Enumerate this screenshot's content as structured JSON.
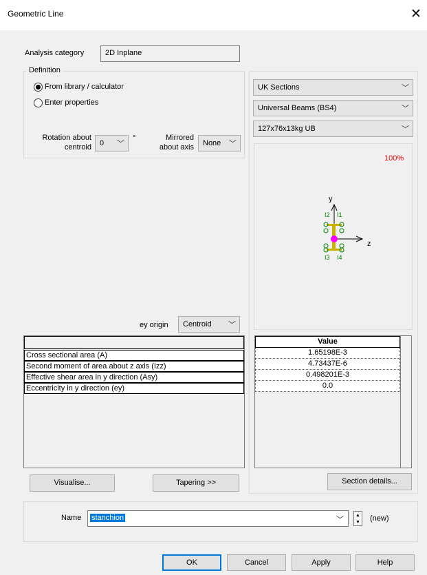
{
  "window": {
    "title": "Geometric Line",
    "close_icon": "✕"
  },
  "analysis_category": {
    "label": "Analysis category",
    "value": "2D Inplane"
  },
  "definition": {
    "legend": "Definition",
    "option_library": "From library / calculator",
    "option_enter": "Enter properties",
    "selected": "library"
  },
  "rotation": {
    "label_line1": "Rotation about",
    "label_line2": "centroid",
    "value": "0",
    "unit": "°"
  },
  "mirrored": {
    "label_line1": "Mirrored",
    "label_line2": "about axis",
    "value": "None"
  },
  "library": {
    "standard": "UK Sections",
    "family": "Universal Beams (BS4)",
    "section": "127x76x13kg UB"
  },
  "preview": {
    "zoom": "100%",
    "y_axis": "y",
    "z_axis": "z",
    "p1": "I1",
    "p2": "I2",
    "p3": "I3",
    "p4": "I4",
    "colors": {
      "zoom": "#ff0000",
      "points": "#008000",
      "flange": "#c8b400",
      "centroid": "#ff00ff"
    }
  },
  "ey_origin": {
    "label": "ey origin",
    "value": "Centroid"
  },
  "properties_table": {
    "value_header": "Value",
    "rows": [
      {
        "name": "Cross sectional area (A)",
        "value": "1.65198E-3"
      },
      {
        "name": "Second moment of area about z axis (Izz)",
        "value": "4.73437E-6"
      },
      {
        "name": "Effective shear area in y direction (Asy)",
        "value": "0.498201E-3"
      },
      {
        "name": "Eccentricity in y direction (ey)",
        "value": "0.0"
      }
    ]
  },
  "buttons": {
    "visualise": "Visualise...",
    "tapering": "Tapering >>",
    "section_details": "Section details...",
    "ok": "OK",
    "cancel": "Cancel",
    "apply": "Apply",
    "help": "Help"
  },
  "name_field": {
    "label": "Name",
    "value": "stanchion",
    "status": "(new)"
  }
}
